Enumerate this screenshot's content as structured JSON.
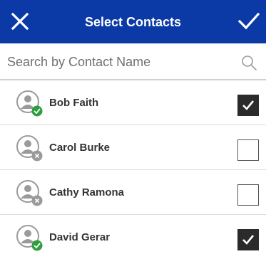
{
  "header": {
    "title": "Select Contacts",
    "close_icon": "close-icon",
    "done_icon": "checkmark-icon",
    "background_color": "#0b3aa7"
  },
  "search": {
    "placeholder": "Search by Contact Name",
    "value": "",
    "icon": "search-icon"
  },
  "contacts": [
    {
      "name": "Bob Faith",
      "status": "online",
      "selected": true
    },
    {
      "name": "Carol Burke",
      "status": "offline",
      "selected": false
    },
    {
      "name": "Cathy Ramona",
      "status": "offline",
      "selected": false
    },
    {
      "name": "David Gerar",
      "status": "online",
      "selected": true
    }
  ],
  "colors": {
    "online": "#2e9e3e",
    "offline": "#9a9a9a",
    "checked": "#2b2b2b"
  }
}
